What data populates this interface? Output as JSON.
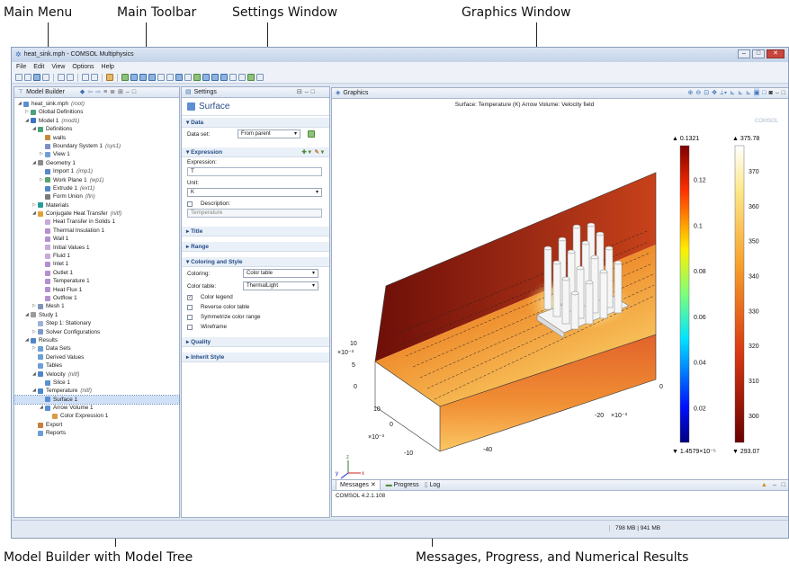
{
  "captions": {
    "main_menu": "Main Menu",
    "main_toolbar": "Main Toolbar",
    "settings_window": "Settings Window",
    "graphics_window": "Graphics Window",
    "model_builder": "Model Builder with Model Tree",
    "messages": "Messages, Progress, and Numerical Results"
  },
  "window": {
    "title": "heat_sink.mph - COMSOL Multiphysics"
  },
  "menu": [
    "File",
    "Edit",
    "View",
    "Options",
    "Help"
  ],
  "model_builder": {
    "tab_label": "Model Builder",
    "tree": [
      {
        "label": "heat_sink.mph",
        "tag": "(root)",
        "level": 0,
        "icon": "#5b8fd1",
        "exp": "down"
      },
      {
        "label": "Global Definitions",
        "tag": "",
        "level": 1,
        "icon": "#4aa37a",
        "exp": "right"
      },
      {
        "label": "Model 1",
        "tag": "(mod1)",
        "level": 1,
        "icon": "#3b74c4",
        "exp": "down"
      },
      {
        "label": "Definitions",
        "tag": "",
        "level": 2,
        "icon": "#4aa37a",
        "exp": "down"
      },
      {
        "label": "walls",
        "tag": "",
        "level": 3,
        "icon": "#c58a3a",
        "exp": ""
      },
      {
        "label": "Boundary System 1",
        "tag": "(sys1)",
        "level": 3,
        "icon": "#7d8fc6",
        "exp": ""
      },
      {
        "label": "View 1",
        "tag": "",
        "level": 3,
        "icon": "#6e9ed8",
        "exp": "right"
      },
      {
        "label": "Geometry 1",
        "tag": "",
        "level": 2,
        "icon": "#8b8b8b",
        "exp": "down"
      },
      {
        "label": "Import 1",
        "tag": "(imp1)",
        "level": 3,
        "icon": "#5a88c8",
        "exp": ""
      },
      {
        "label": "Work Plane 1",
        "tag": "(wp1)",
        "level": 3,
        "icon": "#56a36b",
        "exp": "right"
      },
      {
        "label": "Extrude 1",
        "tag": "(ext1)",
        "level": 3,
        "icon": "#4e87c7",
        "exp": ""
      },
      {
        "label": "Form Union",
        "tag": "(fin)",
        "level": 3,
        "icon": "#7a7a7a",
        "exp": ""
      },
      {
        "label": "Materials",
        "tag": "",
        "level": 2,
        "icon": "#2a9c9a",
        "exp": "right"
      },
      {
        "label": "Conjugate Heat Transfer",
        "tag": "(nitf)",
        "level": 2,
        "icon": "#e0a13d",
        "exp": "down"
      },
      {
        "label": "Heat Transfer in Solids 1",
        "tag": "",
        "level": 3,
        "icon": "#c9a9d8",
        "exp": ""
      },
      {
        "label": "Thermal Insulation 1",
        "tag": "",
        "level": 3,
        "icon": "#b58fcf",
        "exp": ""
      },
      {
        "label": "Wall 1",
        "tag": "",
        "level": 3,
        "icon": "#b58fcf",
        "exp": ""
      },
      {
        "label": "Initial Values 1",
        "tag": "",
        "level": 3,
        "icon": "#c9a9d8",
        "exp": ""
      },
      {
        "label": "Fluid 1",
        "tag": "",
        "level": 3,
        "icon": "#c9a9d8",
        "exp": ""
      },
      {
        "label": "Inlet 1",
        "tag": "",
        "level": 3,
        "icon": "#b58fcf",
        "exp": ""
      },
      {
        "label": "Outlet 1",
        "tag": "",
        "level": 3,
        "icon": "#b58fcf",
        "exp": ""
      },
      {
        "label": "Temperature 1",
        "tag": "",
        "level": 3,
        "icon": "#b58fcf",
        "exp": ""
      },
      {
        "label": "Heat Flux 1",
        "tag": "",
        "level": 3,
        "icon": "#b58fcf",
        "exp": ""
      },
      {
        "label": "Outflow 1",
        "tag": "",
        "level": 3,
        "icon": "#b58fcf",
        "exp": ""
      },
      {
        "label": "Mesh 1",
        "tag": "",
        "level": 2,
        "icon": "#7f95b8",
        "exp": "right"
      },
      {
        "label": "Study 1",
        "tag": "",
        "level": 1,
        "icon": "#9a9a9a",
        "exp": "down"
      },
      {
        "label": "Step 1: Stationary",
        "tag": "",
        "level": 2,
        "icon": "#9db3d6",
        "exp": ""
      },
      {
        "label": "Solver Configurations",
        "tag": "",
        "level": 2,
        "icon": "#7a9ac9",
        "exp": "right"
      },
      {
        "label": "Results",
        "tag": "",
        "level": 1,
        "icon": "#4f86c9",
        "exp": "down"
      },
      {
        "label": "Data Sets",
        "tag": "",
        "level": 2,
        "icon": "#6e9ed8",
        "exp": "right"
      },
      {
        "label": "Derived Values",
        "tag": "",
        "level": 2,
        "icon": "#6e9ed8",
        "exp": ""
      },
      {
        "label": "Tables",
        "tag": "",
        "level": 2,
        "icon": "#6e9ed8",
        "exp": ""
      },
      {
        "label": "Velocity",
        "tag": "(nitf)",
        "level": 2,
        "icon": "#4f86c9",
        "exp": "down"
      },
      {
        "label": "Slice 1",
        "tag": "",
        "level": 3,
        "icon": "#5b8fd1",
        "exp": ""
      },
      {
        "label": "Temperature",
        "tag": "(nitf)",
        "level": 2,
        "icon": "#4f86c9",
        "exp": "down"
      },
      {
        "label": "Surface 1",
        "tag": "",
        "level": 3,
        "icon": "#5b8fd1",
        "exp": "",
        "selected": true
      },
      {
        "label": "Arrow Volume 1",
        "tag": "",
        "level": 3,
        "icon": "#5b8fd1",
        "exp": "down"
      },
      {
        "label": "Color Expression 1",
        "tag": "",
        "level": 4,
        "icon": "#d89a46",
        "exp": ""
      },
      {
        "label": "Export",
        "tag": "",
        "level": 2,
        "icon": "#c77e3c",
        "exp": ""
      },
      {
        "label": "Reports",
        "tag": "",
        "level": 2,
        "icon": "#6e9ed8",
        "exp": ""
      }
    ]
  },
  "settings": {
    "tab_label": "Settings",
    "title": "Surface",
    "data_section": "Data",
    "data_set_label": "Data set:",
    "data_set_value": "From parent",
    "expression_section": "Expression",
    "expression_label": "Expression:",
    "expression_value": "T",
    "unit_label": "Unit:",
    "unit_value": "K",
    "description_label": "Description:",
    "description_value": "Temperature",
    "title_section": "Title",
    "range_section": "Range",
    "coloring_section": "Coloring and Style",
    "coloring_label": "Coloring:",
    "coloring_value": "Color table",
    "color_table_label": "Color table:",
    "color_table_value": "ThermalLight",
    "color_legend": "Color legend",
    "reverse_color": "Reverse color table",
    "symmetrize": "Symmetrize color range",
    "wireframe": "Wireframe",
    "quality_section": "Quality",
    "inherit_section": "Inherit Style"
  },
  "graphics": {
    "tab_label": "Graphics",
    "plot_title": "Surface: Temperature (K)  Arrow Volume: Velocity field",
    "watermark": "COMSOL",
    "legend_left": {
      "max": "▲ 0.1321",
      "min": "▼ 1.4579×10⁻⁵",
      "ticks": [
        "0.12",
        "0.1",
        "0.08",
        "0.06",
        "0.04",
        "0.02"
      ]
    },
    "legend_right": {
      "max": "▲ 375.78",
      "min": "▼ 293.07",
      "ticks": [
        "370",
        "360",
        "350",
        "340",
        "330",
        "320",
        "310",
        "300"
      ]
    },
    "axis_labels": [
      "10",
      "×10⁻³",
      "5",
      "0",
      "10",
      "0",
      "×10⁻³",
      "-10",
      "-20",
      "×10⁻³",
      "-40",
      "0"
    ],
    "axis_triad": {
      "x": "x",
      "y": "y",
      "z": "z"
    }
  },
  "messages": {
    "tabs": [
      "Messages",
      "Progress",
      "Log"
    ],
    "text": "COMSOL 4.2.1.108"
  },
  "status": {
    "memory": "798 MB | 941 MB"
  },
  "colors": {
    "accent": "#3a6fb5",
    "pane_border": "#9fb0c8"
  }
}
